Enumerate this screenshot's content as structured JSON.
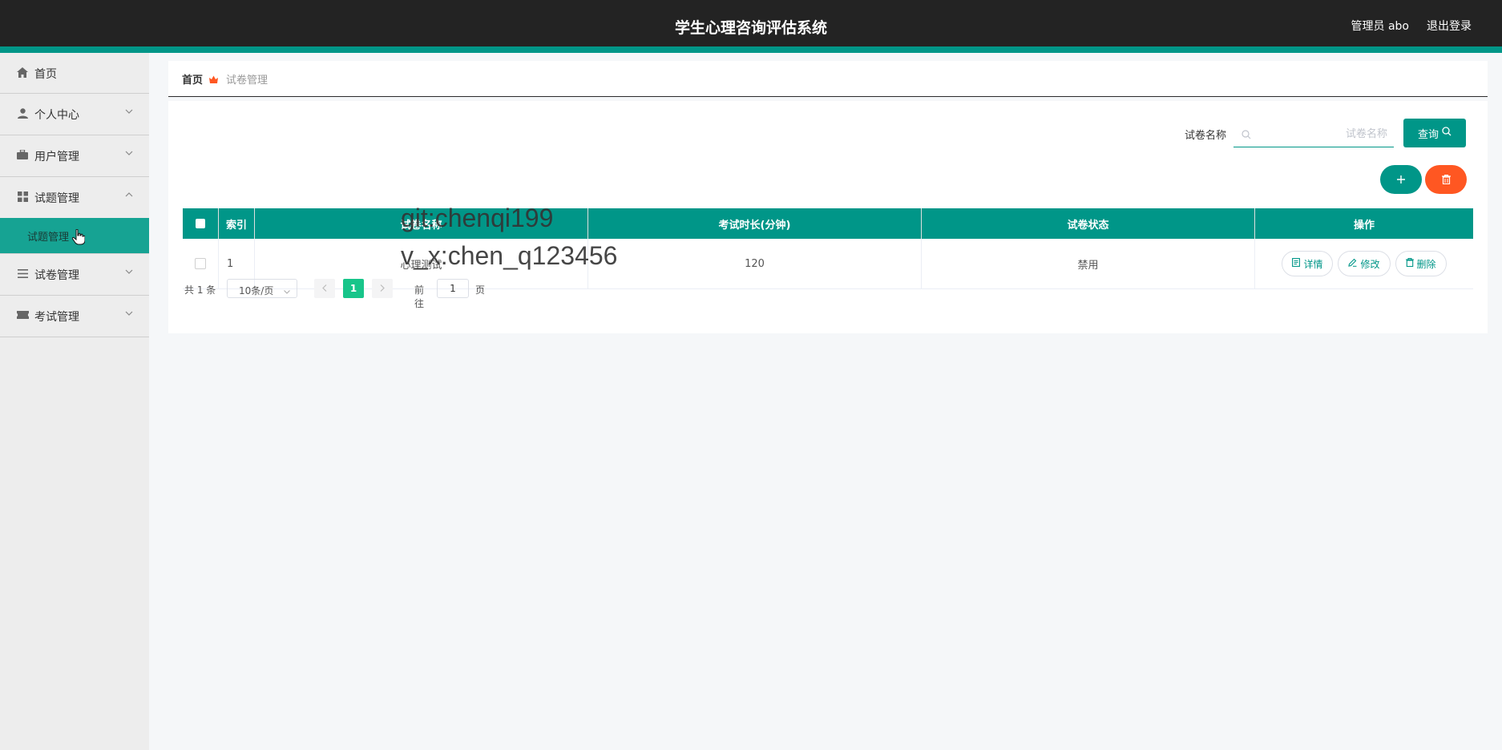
{
  "header": {
    "title": "学生心理咨询评估系统",
    "admin_label": "管理员 abo",
    "logout_label": "退出登录"
  },
  "sidebar": {
    "items": [
      {
        "label": "首页",
        "icon": "home-icon"
      },
      {
        "label": "个人中心",
        "icon": "user-icon"
      },
      {
        "label": "用户管理",
        "icon": "briefcase-icon"
      },
      {
        "label": "试题管理",
        "icon": "grid-icon",
        "children": [
          {
            "label": "试题管理"
          }
        ]
      },
      {
        "label": "试卷管理",
        "icon": "list-icon"
      },
      {
        "label": "考试管理",
        "icon": "ticket-icon"
      }
    ]
  },
  "breadcrumb": {
    "home": "首页",
    "current": "试卷管理"
  },
  "search": {
    "label": "试卷名称",
    "placeholder": "试卷名称",
    "query_label": "查询"
  },
  "table": {
    "headers": [
      "索引",
      "试卷名称",
      "考试时长(分钟)",
      "试卷状态",
      "操作"
    ],
    "rows": [
      {
        "index": "1",
        "name": "心理测试",
        "duration": "120",
        "status": "禁用"
      }
    ],
    "actions": {
      "detail": "详情",
      "edit": "修改",
      "delete": "删除"
    }
  },
  "pagination": {
    "total": "共 1 条",
    "page_size": "10条/页",
    "current_page": "1",
    "goto_label": "前往",
    "goto_value": "1",
    "page_unit": "页"
  },
  "watermark": {
    "line1": "git:chenqi199",
    "line2": "v_x:chen_q123456"
  },
  "colors": {
    "primary": "#009688",
    "danger": "#ff5722",
    "header_bg": "#232323",
    "page_active": "#18c58a"
  }
}
